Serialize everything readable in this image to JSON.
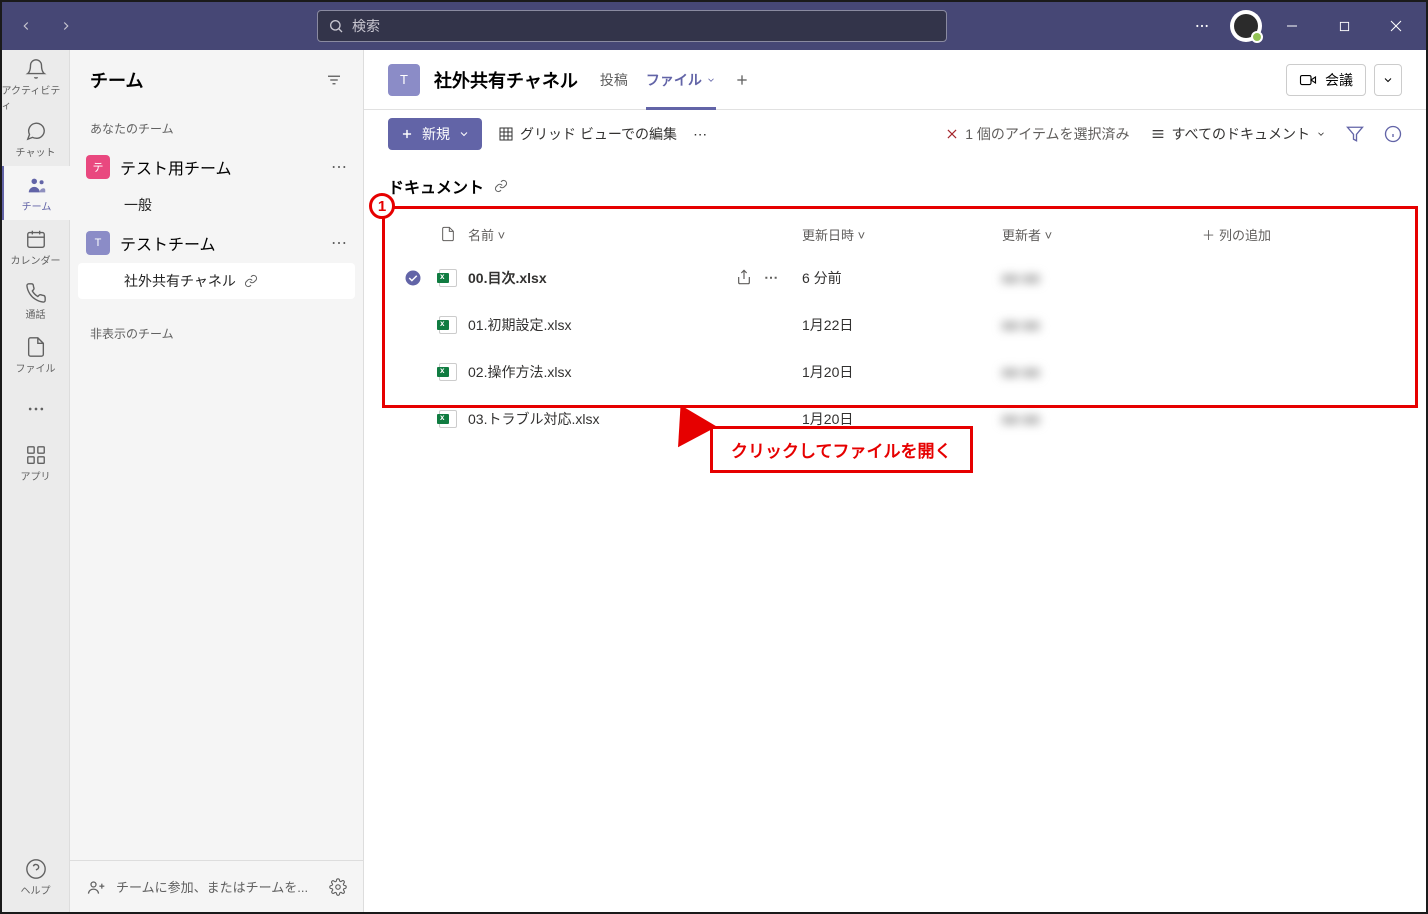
{
  "search": {
    "placeholder": "検索"
  },
  "rail": {
    "activity": "アクティビティ",
    "chat": "チャット",
    "teams": "チーム",
    "calendar": "カレンダー",
    "calls": "通話",
    "files": "ファイル",
    "apps": "アプリ",
    "help": "ヘルプ"
  },
  "sidebar": {
    "title": "チーム",
    "yourTeams": "あなたのチーム",
    "hiddenTeams": "非表示のチーム",
    "teams": [
      {
        "avatar": "テ",
        "name": "テスト用チーム",
        "channels": [
          {
            "name": "一般"
          }
        ]
      },
      {
        "avatar": "T",
        "name": "テストチーム",
        "channels": [
          {
            "name": "社外共有チャネル",
            "active": true
          }
        ]
      }
    ],
    "joinCreate": "チームに参加、またはチームを..."
  },
  "channel": {
    "avatar": "T",
    "name": "社外共有チャネル",
    "tabs": {
      "posts": "投稿",
      "files": "ファイル"
    },
    "meet": "会議"
  },
  "toolbar": {
    "newBtn": "新規",
    "gridEdit": "グリッド ビューでの編集",
    "selected": "1 個のアイテムを選択済み",
    "viewAll": "すべてのドキュメント"
  },
  "docs": {
    "title": "ドキュメント",
    "columns": {
      "name": "名前",
      "modified": "更新日時",
      "modifiedBy": "更新者",
      "addCol": "列の追加"
    },
    "rows": [
      {
        "name": "00.目次.xlsx",
        "date": "6 分前",
        "author": "■■ ■■",
        "selected": true
      },
      {
        "name": "01.初期設定.xlsx",
        "date": "1月22日",
        "author": "■■ ■■"
      },
      {
        "name": "02.操作方法.xlsx",
        "date": "1月20日",
        "author": "■■ ■■"
      },
      {
        "name": "03.トラブル対応.xlsx",
        "date": "1月20日",
        "author": "■■ ■■"
      }
    ]
  },
  "annotation": {
    "num": "1",
    "label": "クリックしてファイルを開く"
  }
}
